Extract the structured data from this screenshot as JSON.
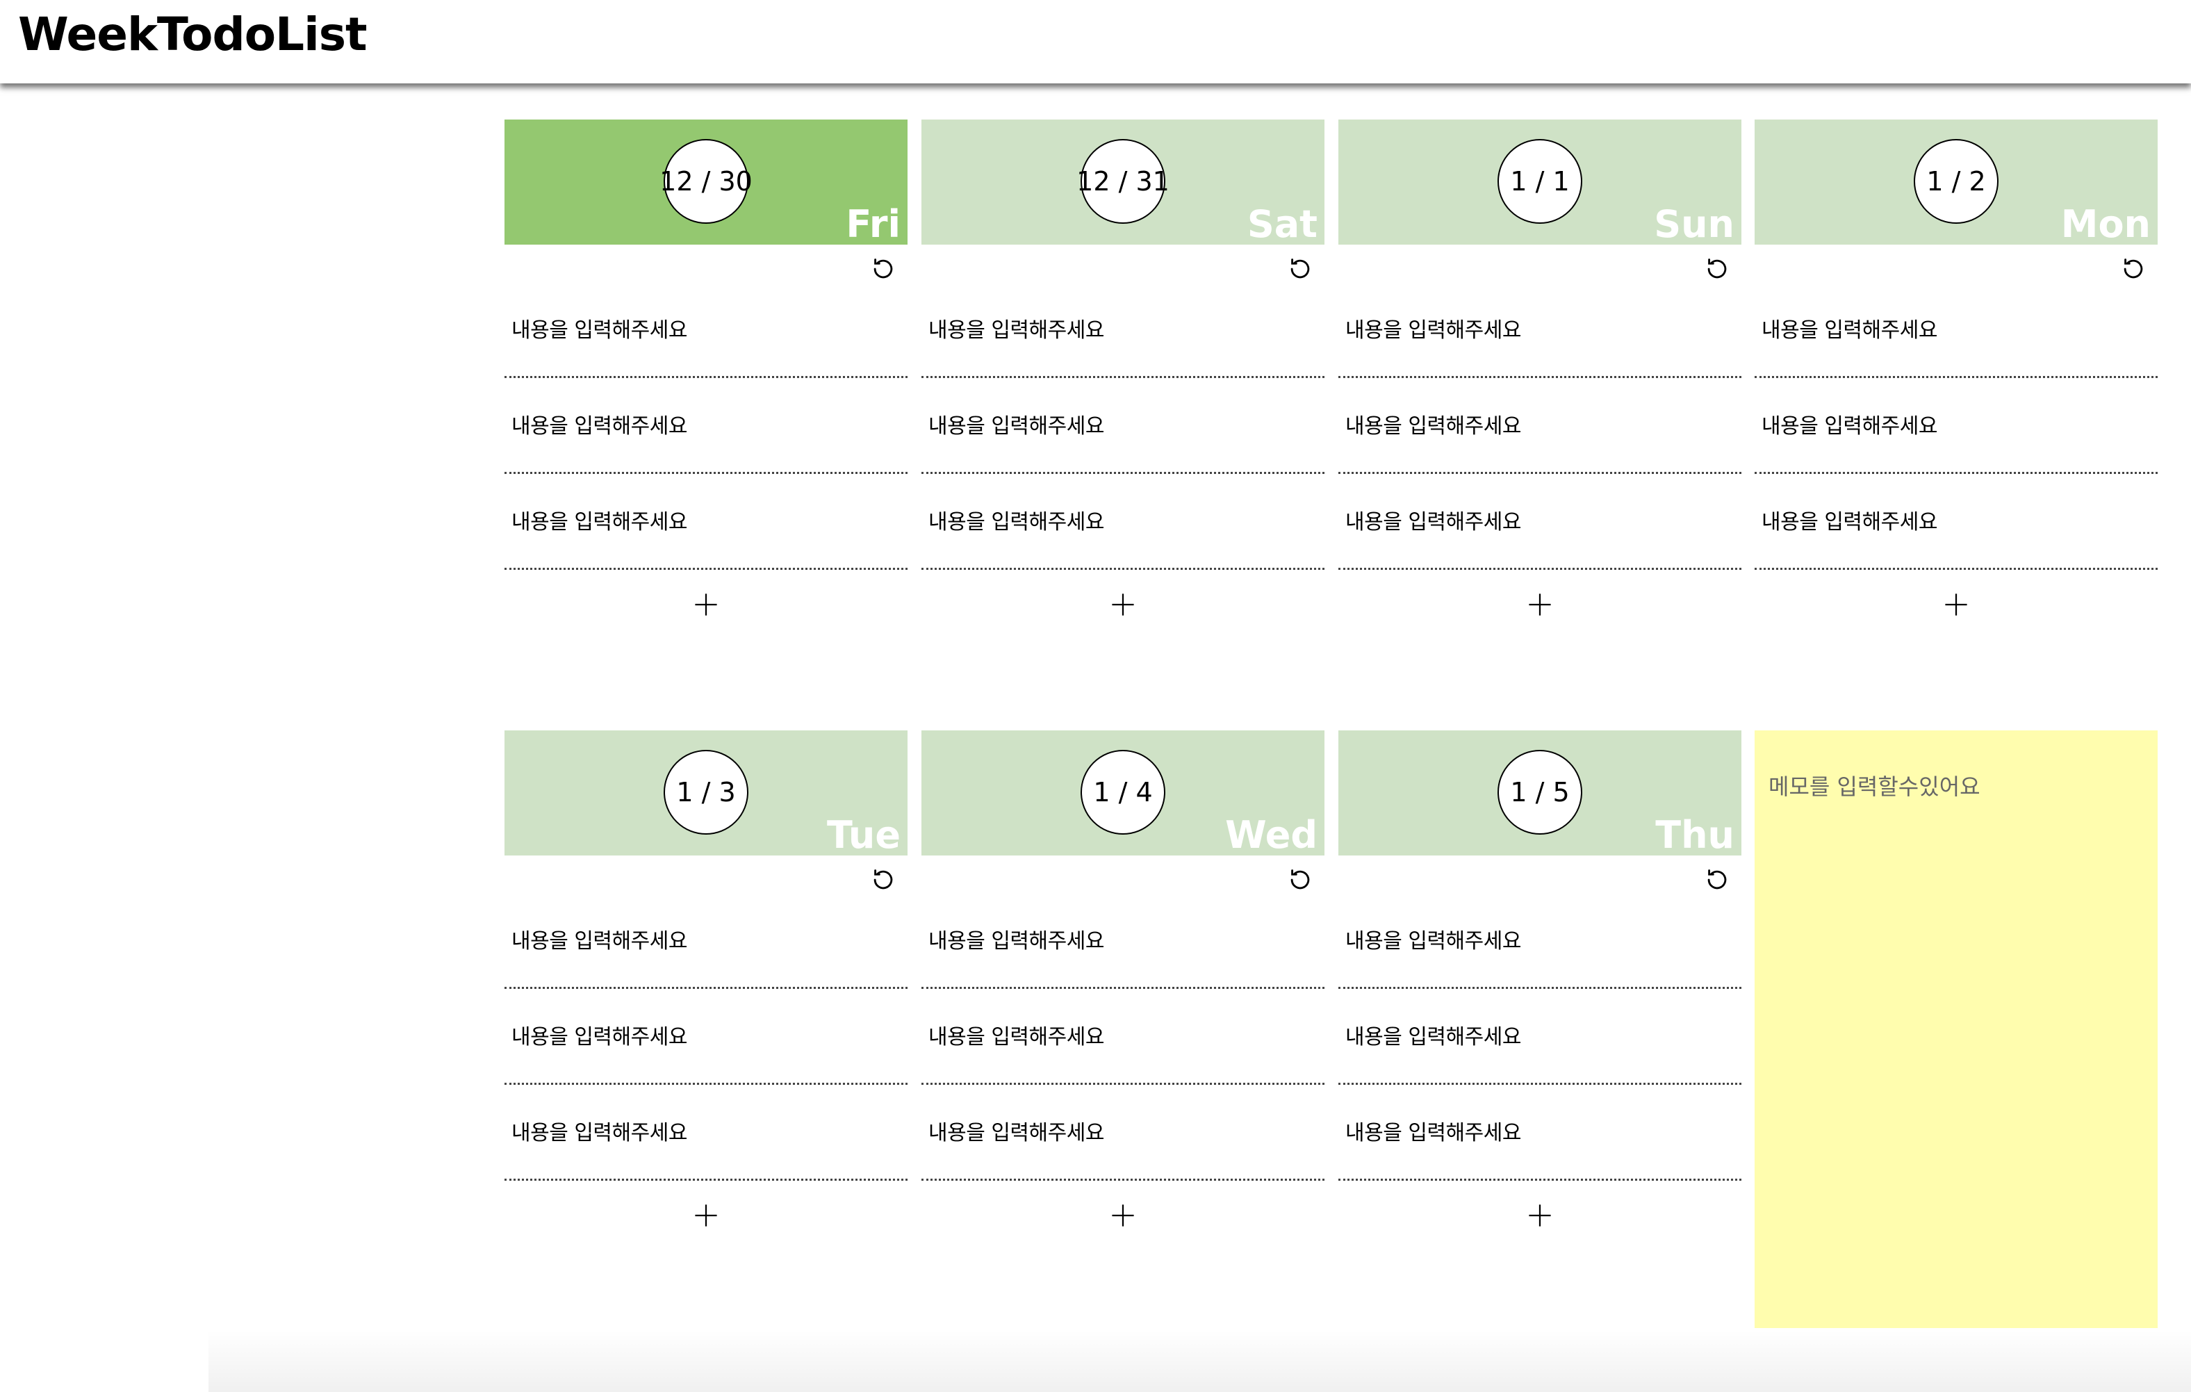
{
  "app": {
    "title": "WeekTodoList"
  },
  "days": [
    {
      "date": "12 / 30",
      "weekday": "Fri",
      "today": true,
      "todos": [
        "내용을 입력해주세요",
        "내용을 입력해주세요",
        "내용을 입력해주세요"
      ],
      "add_label": "+"
    },
    {
      "date": "12 / 31",
      "weekday": "Sat",
      "today": false,
      "todos": [
        "내용을 입력해주세요",
        "내용을 입력해주세요",
        "내용을 입력해주세요"
      ],
      "add_label": "+"
    },
    {
      "date": "1 / 1",
      "weekday": "Sun",
      "today": false,
      "todos": [
        "내용을 입력해주세요",
        "내용을 입력해주세요",
        "내용을 입력해주세요"
      ],
      "add_label": "+"
    },
    {
      "date": "1 / 2",
      "weekday": "Mon",
      "today": false,
      "todos": [
        "내용을 입력해주세요",
        "내용을 입력해주세요",
        "내용을 입력해주세요"
      ],
      "add_label": "+"
    },
    {
      "date": "1 / 3",
      "weekday": "Tue",
      "today": false,
      "todos": [
        "내용을 입력해주세요",
        "내용을 입력해주세요",
        "내용을 입력해주세요"
      ],
      "add_label": "+"
    },
    {
      "date": "1 / 4",
      "weekday": "Wed",
      "today": false,
      "todos": [
        "내용을 입력해주세요",
        "내용을 입력해주세요",
        "내용을 입력해주세요"
      ],
      "add_label": "+"
    },
    {
      "date": "1 / 5",
      "weekday": "Thu",
      "today": false,
      "todos": [
        "내용을 입력해주세요",
        "내용을 입력해주세요",
        "내용을 입력해주세요"
      ],
      "add_label": "+"
    }
  ],
  "memo": {
    "placeholder": "메모를 입력할수있어요"
  },
  "icons": {
    "reset": "refresh-icon",
    "add": "plus-icon"
  },
  "colors": {
    "today_header": "#94c870",
    "day_header": "#cfe2c6",
    "memo_bg": "#fffdae",
    "weekday_text": "#ffffff"
  }
}
